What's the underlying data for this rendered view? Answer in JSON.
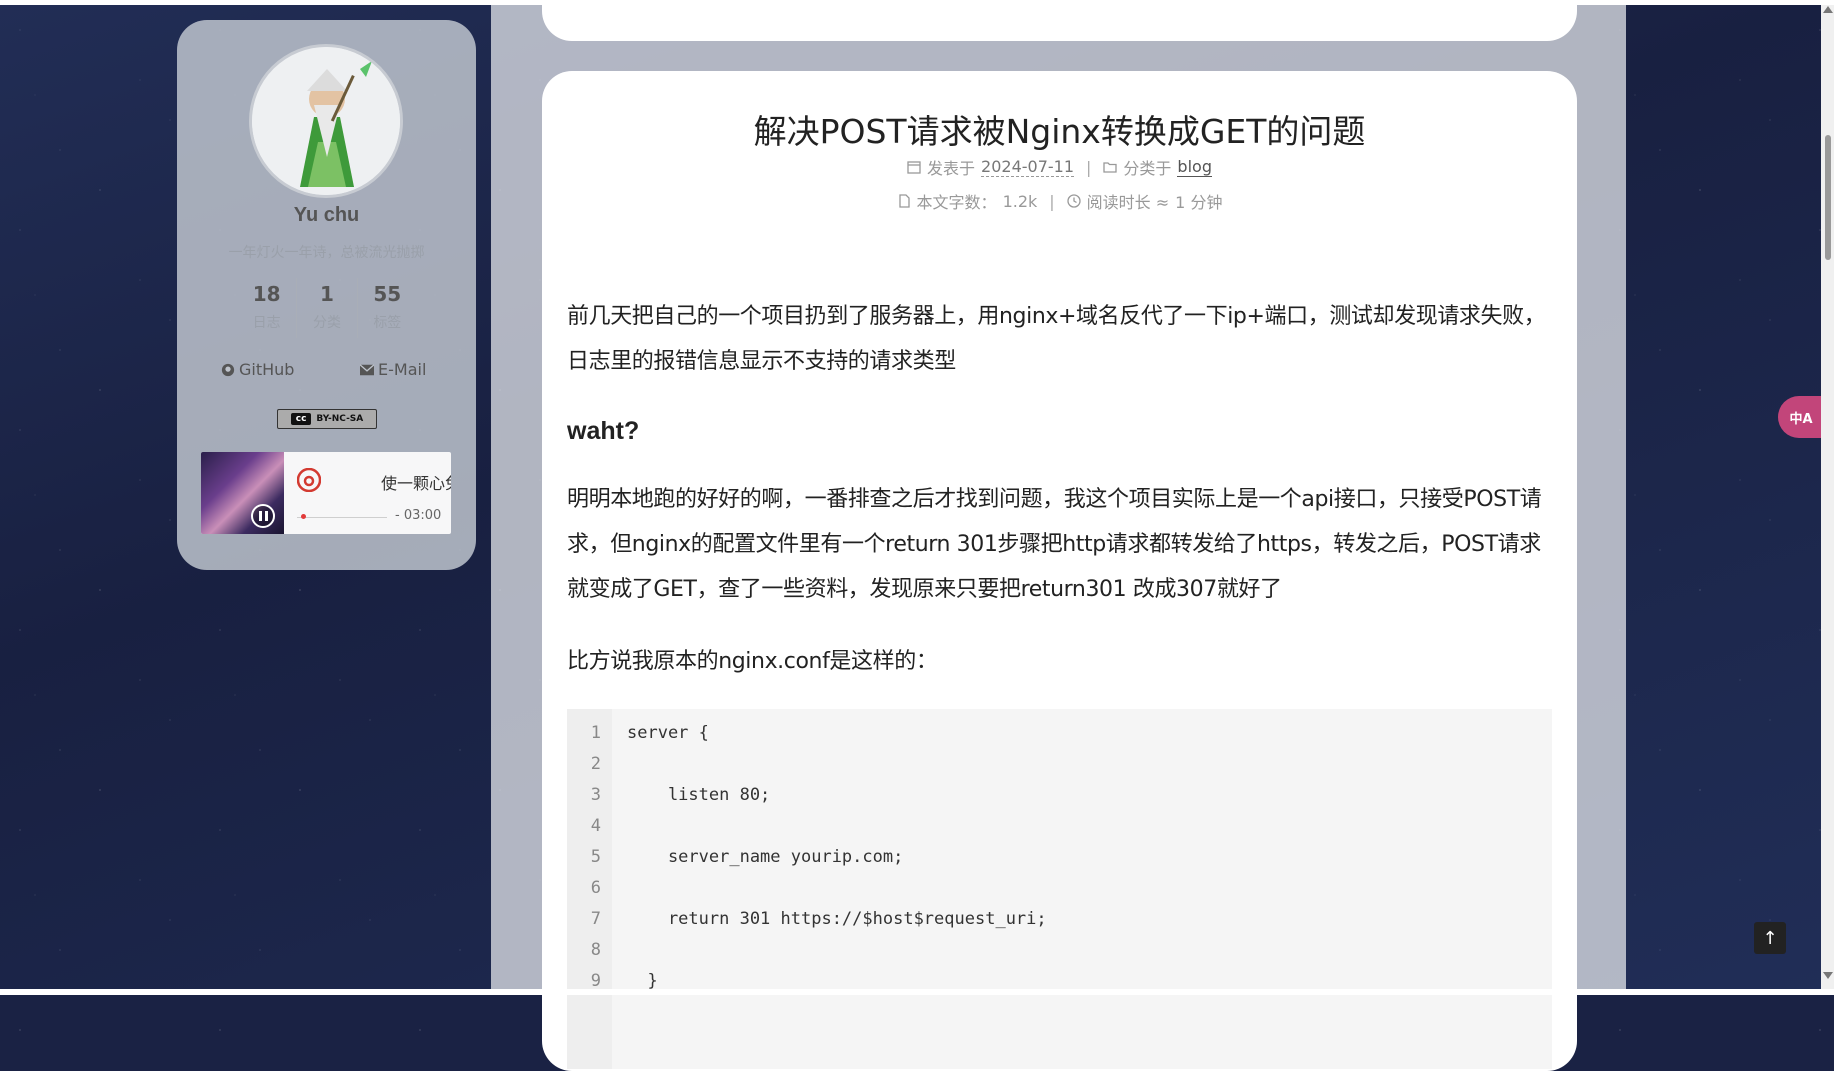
{
  "sidebar": {
    "author": "Yu chu",
    "motto": "一年灯火一年诗，总被流光抛掷",
    "stats": [
      {
        "num": "18",
        "label": "日志"
      },
      {
        "num": "1",
        "label": "分类"
      },
      {
        "num": "55",
        "label": "标签"
      }
    ],
    "links": {
      "github": "GitHub",
      "email": "E-Mail"
    },
    "license": "BY-NC-SA",
    "player": {
      "song": "使一颗心免于哀伤",
      "time": "- 03:00",
      "progress": 0.04
    }
  },
  "post": {
    "title": "解决POST请求被Nginx转换成GET的问题",
    "meta": {
      "posted_label": "发表于",
      "date": "2024-07-11",
      "category_label": "分类于",
      "category": "blog",
      "words_label": "本文字数：",
      "words": "1.2k",
      "read_label": "阅读时长 ≈",
      "read_time": "1 分钟"
    },
    "p1": "前几天把自己的一个项目扔到了服务器上，用nginx+域名反代了一下ip+端口，测试却发现请求失败，日志里的报错信息显示不支持的请求类型",
    "h2": "waht?",
    "p2": "明明本地跑的好好的啊，一番排查之后才找到问题，我这个项目实际上是一个api接口，只接受POST请求，但nginx的配置文件里有一个return 301步骤把http请求都转发给了https，转发之后，POST请求就变成了GET，查了一些资料，发现原来只要把return301 改成307就好了",
    "p3": "比方说我原本的nginx.conf是这样的：",
    "code": {
      "line_numbers": [
        "1",
        "2",
        "3",
        "4",
        "5",
        "6",
        "7",
        "8",
        "9"
      ],
      "lines": [
        "server {",
        "",
        "    listen 80;",
        "",
        "    server_name yourip.com;",
        "",
        "    return 301 https://$host$request_uri;",
        "",
        "  }"
      ]
    }
  },
  "ui": {
    "translate_label": "中A",
    "back_to_top": "↑"
  }
}
